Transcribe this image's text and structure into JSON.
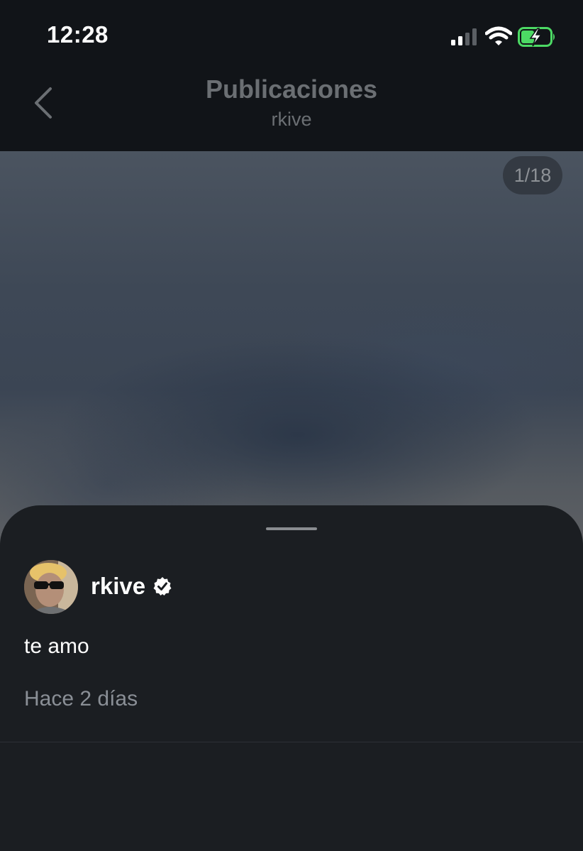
{
  "status_bar": {
    "time": "12:28"
  },
  "header": {
    "title": "Publicaciones",
    "subtitle": "rkive",
    "back_icon": "chevron-left-icon"
  },
  "photo": {
    "page_counter": "1/18"
  },
  "post": {
    "username": "rkive",
    "verified_icon": "verified-badge-icon",
    "caption": "te amo",
    "timestamp": "Hace 2 días"
  },
  "colors": {
    "background": "#1b1e22",
    "header_background": "#111418",
    "muted_text": "#8a8f96",
    "battery_charge": "#4cd964"
  }
}
